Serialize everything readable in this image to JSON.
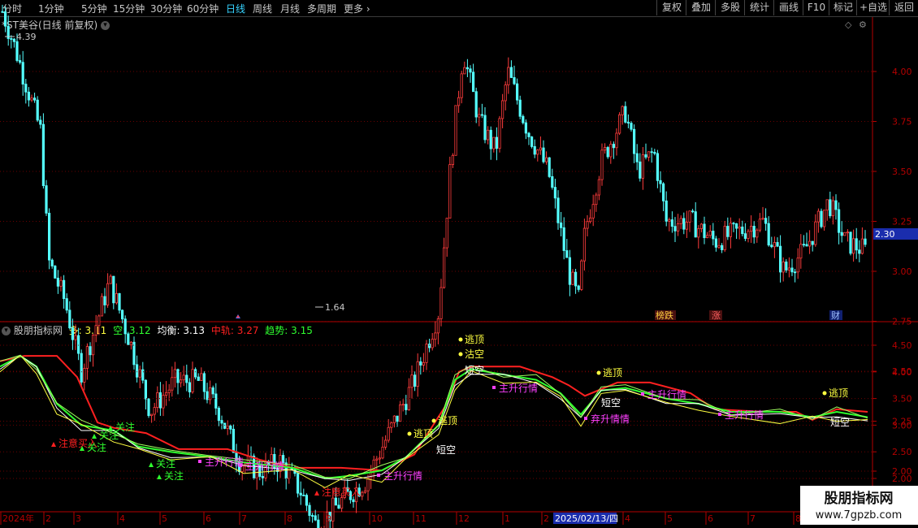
{
  "toolbar": {
    "periods": [
      "分时",
      "1分钟",
      "5分钟",
      "15分钟",
      "30分钟",
      "60分钟",
      "日线",
      "周线",
      "月线",
      "多周期",
      "更多"
    ],
    "active_period": "日线",
    "right_buttons": [
      "复权",
      "叠加",
      "多股",
      "统计",
      "画线",
      "F10",
      "标记",
      "+自选",
      "返回"
    ]
  },
  "main_chart": {
    "title": "*ST美谷(日线 前复权)",
    "price_high_label": "4.39",
    "price_low_label": "1.64",
    "current_price_tag": "2.30",
    "y_ticks": [
      "4.00",
      "3.75",
      "3.50",
      "3.25",
      "3.00",
      "2.75",
      "2.50",
      "2.25",
      "2.00"
    ],
    "markers": {
      "red_label_1": "榜跌",
      "red_label_2": "涨",
      "blue_label": "财"
    }
  },
  "indicator": {
    "name": "股朋指标网",
    "duo_label": "多: 3.11",
    "kong_label": "空: 3.12",
    "junheng_label": "均衡: 3.13",
    "zhonggui_label": "中轨: 3.27",
    "qushi_label": "趋势: 3.15",
    "y_ticks": [
      "4.50",
      "4.00",
      "3.50",
      "3.00",
      "2.50",
      "2.00"
    ],
    "annotations": [
      "逃顶",
      "沽空",
      "短空",
      "逃顶",
      "逃顶",
      "短空",
      "逃顶",
      "短空",
      "逃顶",
      "短空",
      "主升行情",
      "主升行情",
      "主升行情",
      "主升行情",
      "主升行情",
      "弃升情情",
      "主升行情",
      "注意买入",
      "注意买入",
      "关注",
      "关注",
      "关注",
      "关注",
      "关注"
    ]
  },
  "x_axis": {
    "labels": [
      "2024年",
      "2",
      "3",
      "4",
      "5",
      "6",
      "7",
      "8",
      "9",
      "10",
      "11",
      "12",
      "1",
      "2",
      "4",
      "5",
      "6",
      "7",
      "8"
    ],
    "cursor_date": "2025/02/13/四"
  },
  "watermark": {
    "line1": "股朋指标网",
    "line2": "www.7gpzb.com"
  },
  "colors": {
    "up": "#ff3c3c",
    "down": "#54ffff",
    "bull": "#ffff40",
    "bear": "#2fff2f",
    "mid": "#ff2020",
    "neutral": "#ffffff",
    "magenta": "#ff40ff",
    "axis": "#b40000"
  }
}
